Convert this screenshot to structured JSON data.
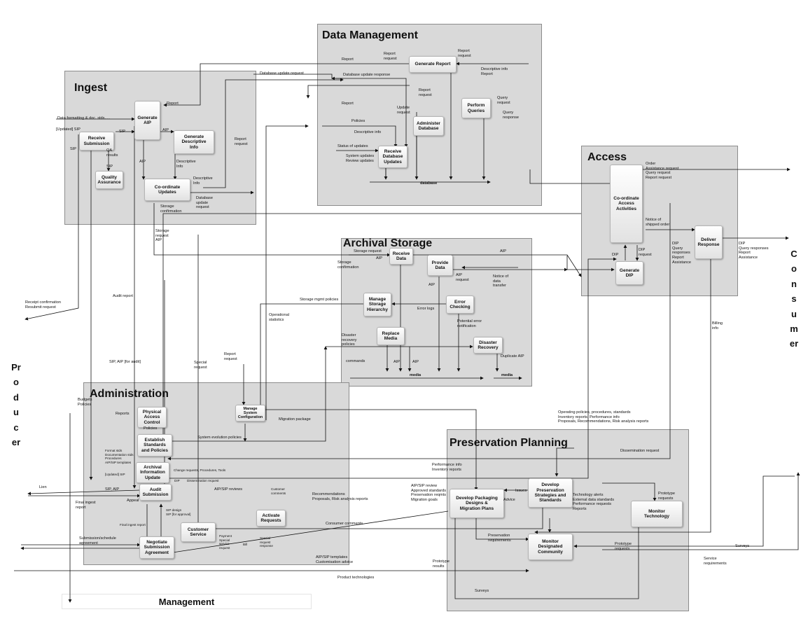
{
  "regions": {
    "data_management": "Data Management",
    "ingest": "Ingest",
    "access": "Access",
    "archival_storage": "Archival Storage",
    "administration": "Administration",
    "preservation_planning": "Preservation Planning",
    "management": "Management"
  },
  "actors": {
    "producer": "Producer",
    "consumer": "Consumer"
  },
  "functions": {
    "generate_report": "Generate Report",
    "perform_queries": "Perform\nQueries",
    "administer_database": "Administer\nDatabase",
    "receive_database_updates": "Receive\nDatabase\nUpdates",
    "database": "database",
    "generate_aip": "Generate\nAIP",
    "receive_submission": "Receive\nSubmission",
    "generate_descriptive_info": "Generate\nDescriptive\nInfo",
    "quality_assurance": "Quality\nAssurance",
    "coordinate_updates": "Co-ordinate\nUpdates",
    "coordinate_access_activities": "Co-ordinate\nAccess\nActivities",
    "deliver_response": "Deliver\nResponse",
    "generate_dip": "Generate\nDIP",
    "receive_data": "Receive\nData",
    "provide_data": "Provide\nData",
    "manage_storage_hierarchy": "Manage\nStorage\nHierarchy",
    "error_checking": "Error\nChecking",
    "replace_media": "Replace\nMedia",
    "disaster_recovery": "Disaster\nRecovery",
    "media": "media",
    "media_2": "media",
    "manage_system_configuration": "Manage\nSystem\nConfiguration",
    "physical_access_control": "Physical\nAccess\nControl",
    "establish_standards": "Establish\nStandards\nand Policies",
    "archival_information_update": "Archival\nInformation\nUpdate",
    "audit_submission": "Audit\nSubmission",
    "customer_service": "Customer\nService",
    "activate_requests": "Activate\nRequests",
    "negotiate_submission": "Negotiate\nSubmission\nAgreement",
    "develop_packaging": "Develop Packaging\nDesigns &\nMigration Plans",
    "develop_preservation": "Develop\nPreservation\nStrategies and\nStandards",
    "monitor_technology": "Monitor\nTechnology",
    "monitor_community": "Monitor\nDesignated\nCommunity"
  },
  "labels": [
    "Report",
    "Report\nrequest",
    "Report\nrequest",
    "Descriptive info\nReport",
    "Database update request",
    "Database update response",
    "Report",
    "Report\nrequest",
    "Query\nrequest",
    "Query\nresponse",
    "Report",
    "Update\nrequest",
    "Policies",
    "Descriptive info",
    "Status of updates",
    "System updates\nReview updates",
    "Data formatting & doc. stds.....",
    "[Updated] SIP",
    "SIP",
    "AIP",
    "SIP",
    "QA\nresults",
    "SIP",
    "AIP",
    "Descriptive\nInfo",
    "Descriptive\nInfo",
    "Database\nupdate\nrequest",
    "Report\nrequest",
    "Storage\nconfirmation",
    "Storage\nrequest\nAIP",
    "Order\nAssistance request\nQuery request\nReport request",
    "Notice of\nshipped order",
    "DIP",
    "DIP\nrequest",
    "DIP\nQuery\nresponses\nReport\nAssistance",
    "DIP\nQuery responses\nReport\nAssistance",
    "AIP",
    "Storage request",
    "AIP",
    "Storage\nconfirmation",
    "AIP\nrequest",
    "AIP",
    "Notice of\ndata\ntransfer",
    "Storage mgmt policies",
    "Error logs",
    "Potential error\nnotification",
    "Disaster\nrecovery\npolicies",
    "commands",
    "AIP",
    "AIP",
    "Duplicate AIP",
    "Operational\nstatistics",
    "Billing\ninfo",
    "Receipt confirmation\nResubmit request",
    "Audit report",
    "SIP, AIP [for audit]",
    "Special\nrequest",
    "Report\nrequest",
    "Budgets\nPolicies",
    "Reports",
    "Policies",
    "System evolution policies",
    "Migration package",
    "Format stds\nDocumentation stds\nProcedures\nAIP/SIP templates",
    "[Updated] SIP",
    "Change requests, Procedures, Tools",
    "DIP",
    "Dissemination request",
    "AIP/SIP reviews",
    "Lien",
    "SIP, AIP",
    "Appeal",
    "Final ingest\nreport",
    "SIP design\nSIP [for approval]",
    "Final ingest report",
    "Customer\ncomments",
    "Submission/schedule\nagreement",
    "Payment\nSpecial\nservice\nrequest",
    "Bill",
    "Special\nrequest\nresponse",
    "Operating policies, procedures, standards\nInventory reports, Performance info\nProposals, Recommendations, Risk analysis reports",
    "Dissemination request",
    "Performance info\nInventory reports",
    "Recommendations\nProposals, Risk analysis reports",
    "AIP/SIP review\nApproved standards\nPreservation reqmts\nMigration goals",
    "Issues",
    "Advice",
    "Technology alerts\nExternal data standards\nPerformance requests\nReports",
    "Prototype\nrequests",
    "Consumer comments",
    "Preservation\nrequirements",
    "Prototype\nrequests",
    "Surveys",
    "AIP/SIP templates\nCustomisation advice",
    "Prototype\nresults",
    "Service\nrequirements",
    "Product technologies",
    "Surveys"
  ]
}
